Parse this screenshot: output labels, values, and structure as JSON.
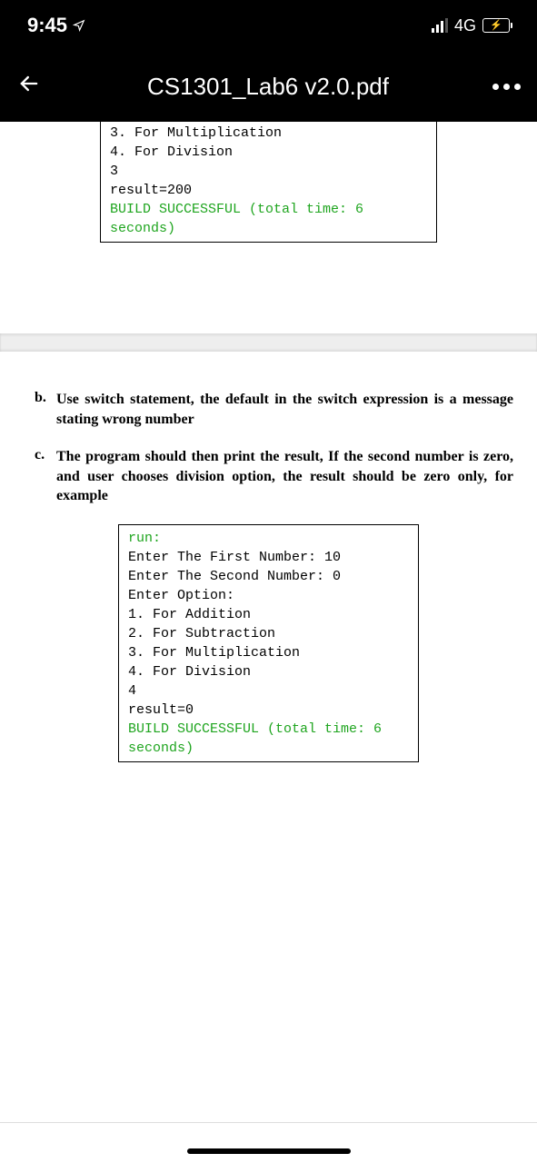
{
  "status": {
    "time": "9:45",
    "network": "4G"
  },
  "header": {
    "title": "CS1301_Lab6 v2.0.pdf"
  },
  "partialCode": {
    "line1": "3. For Multiplication",
    "line2": "4. For Division",
    "line3": "3",
    "line4": "result=200",
    "line5": "BUILD SUCCESSFUL (total time: 6 seconds)"
  },
  "instructions": {
    "b": {
      "marker": "b.",
      "text": "Use switch statement, the default in the switch expression is a message stating wrong number"
    },
    "c": {
      "marker": "c.",
      "text": "The program should then print the result, If the second number is zero, and user chooses division option, the result should be zero only, for example"
    }
  },
  "code": {
    "run": "run:",
    "l1": "Enter The First Number: 10",
    "l2": "Enter The Second Number: 0",
    "l3": "Enter Option:",
    "l4": "1. For Addition",
    "l5": "2. For Subtraction",
    "l6": "3. For Multiplication",
    "l7": "4. For Division",
    "l8": "4",
    "l9": "result=0",
    "l10": "BUILD SUCCESSFUL (total time: 6 seconds)"
  }
}
